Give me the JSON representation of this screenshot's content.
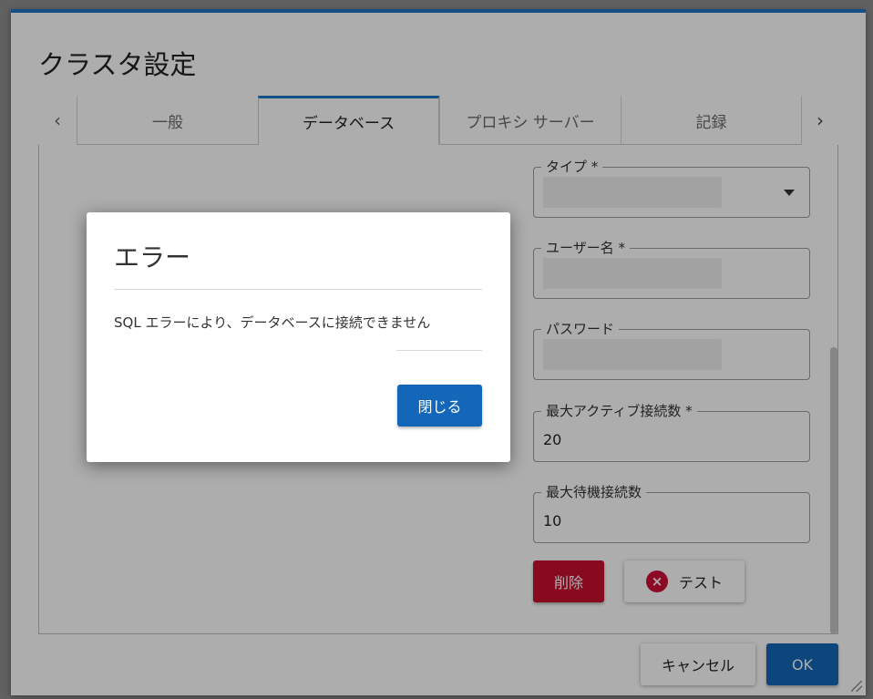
{
  "dialog": {
    "title": "クラスタ設定",
    "tab_prev": "‹",
    "tab_next": "›",
    "tabs": [
      {
        "label": "一般"
      },
      {
        "label": "データベース"
      },
      {
        "label": "プロキシ サーバー"
      },
      {
        "label": "記録"
      }
    ],
    "active_tab": "データベース"
  },
  "form": {
    "type": {
      "label": "タイプ *",
      "value": ""
    },
    "username": {
      "label": "ユーザー名 *",
      "value": ""
    },
    "password": {
      "label": "パスワード",
      "value": ""
    },
    "max_active": {
      "label": "最大アクティブ接続数 *",
      "value": "20"
    },
    "max_idle": {
      "label": "最大待機接続数",
      "value": "10"
    },
    "delete_label": "削除",
    "test_label": "テスト"
  },
  "footer": {
    "cancel_label": "キャンセル",
    "ok_label": "OK"
  },
  "error_dialog": {
    "title": "エラー",
    "message": "SQL エラーにより、データベースに接続できません",
    "close_label": "閉じる"
  },
  "colors": {
    "accent": "#1f76c4",
    "primary_button": "#1466b8",
    "danger_button": "#c8102e",
    "error_icon": "#d0103a"
  },
  "icons": {
    "test_button_icon": "error-circle-icon",
    "type_dropdown_icon": "caret-down-icon"
  }
}
